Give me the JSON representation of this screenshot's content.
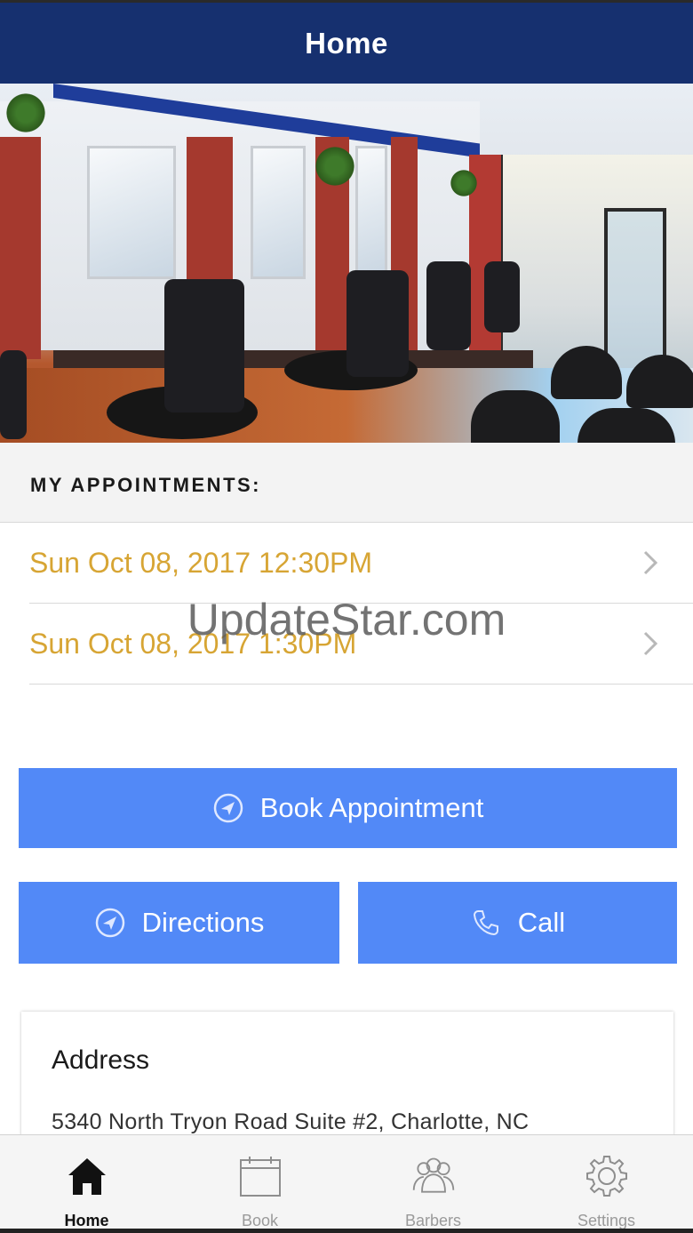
{
  "header": {
    "title": "Home"
  },
  "appointments": {
    "section_label": "MY APPOINTMENTS:",
    "items": [
      {
        "label": "Sun Oct 08, 2017 12:30PM"
      },
      {
        "label": "Sun Oct 08, 2017 1:30PM"
      }
    ]
  },
  "watermark": "UpdateStar.com",
  "actions": {
    "book": {
      "label": "Book Appointment",
      "icon": "navigation-arrow-icon"
    },
    "directions": {
      "label": "Directions",
      "icon": "navigation-arrow-icon"
    },
    "call": {
      "label": "Call",
      "icon": "phone-icon"
    }
  },
  "address_card": {
    "heading": "Address",
    "address": "5340 North Tryon Road Suite #2, Charlotte, NC"
  },
  "tabs": [
    {
      "label": "Home",
      "icon": "home-icon",
      "active": true
    },
    {
      "label": "Book",
      "icon": "calendar-icon",
      "active": false
    },
    {
      "label": "Barbers",
      "icon": "people-icon",
      "active": false
    },
    {
      "label": "Settings",
      "icon": "gear-icon",
      "active": false
    }
  ],
  "colors": {
    "header_bg": "#16306f",
    "button_bg": "#5289f7",
    "appointment_text": "#d7a534",
    "tab_inactive": "#9a9a9a"
  }
}
